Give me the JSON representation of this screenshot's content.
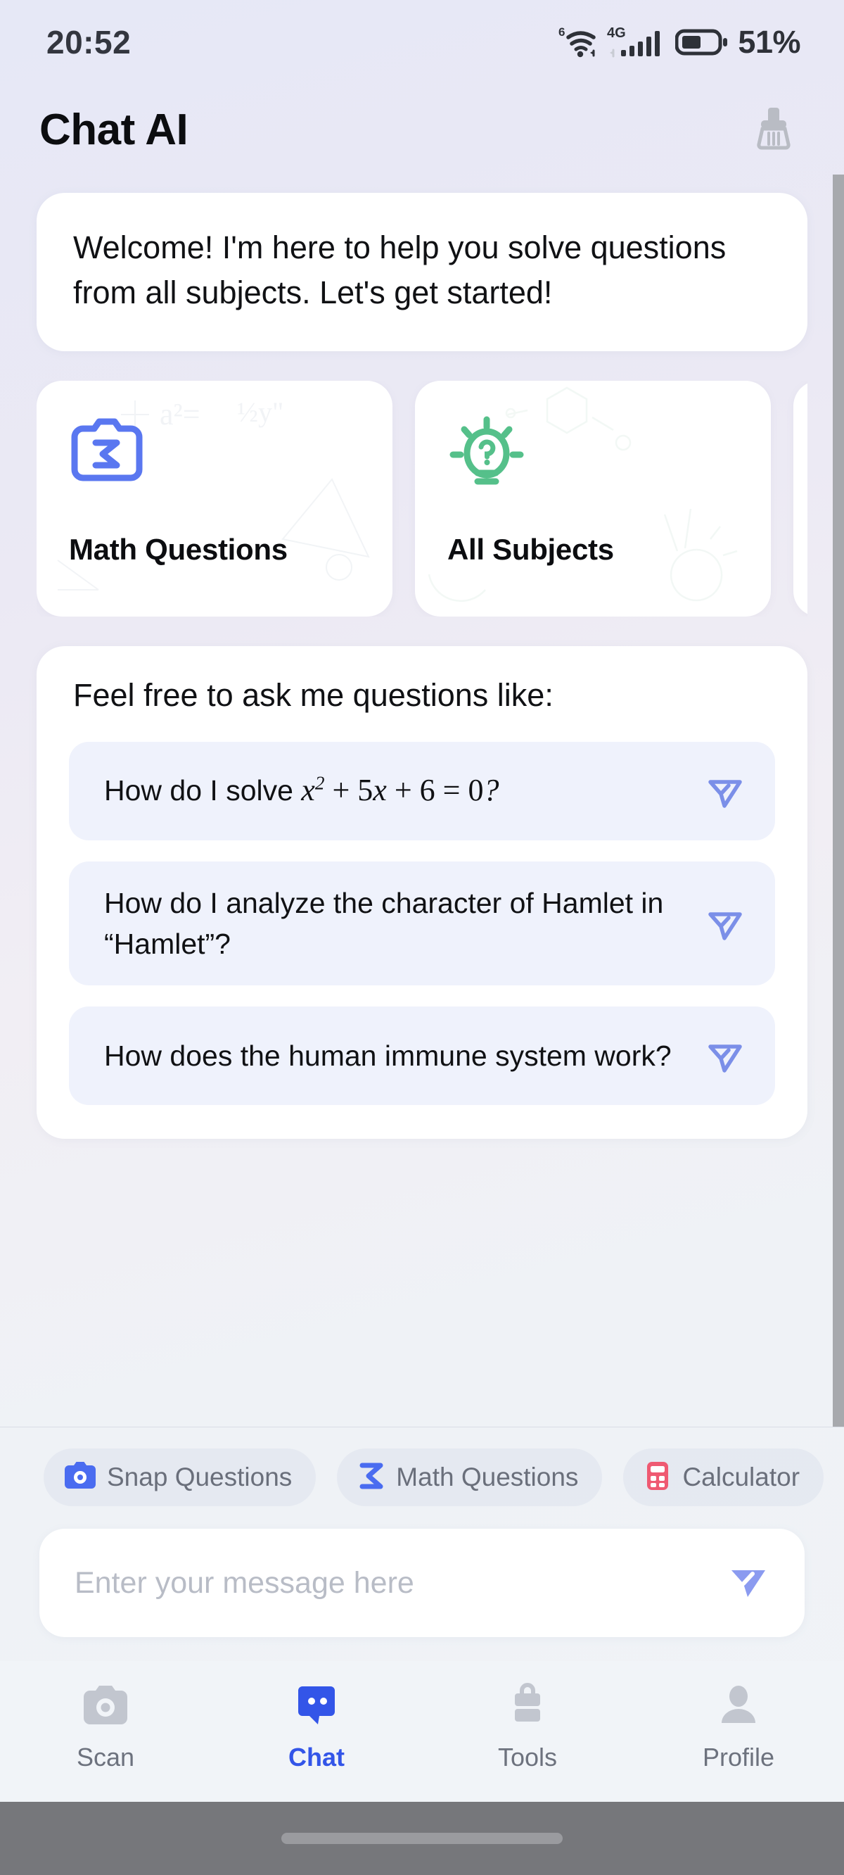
{
  "status_bar": {
    "time": "20:52",
    "wifi_generation": "6",
    "network_type": "4G",
    "battery_percent": "51%"
  },
  "header": {
    "title": "Chat AI",
    "clear_icon": "broom-icon"
  },
  "welcome": {
    "message": "Welcome! I'm here to help you solve questions from all subjects. Let's get started!"
  },
  "categories": [
    {
      "label": "Math Questions",
      "icon": "camera-sigma-icon",
      "color": "#5a77f0"
    },
    {
      "label": "All Subjects",
      "icon": "lightbulb-question-icon",
      "color": "#55c08a"
    }
  ],
  "suggestions": {
    "title": "Feel free to ask me questions like:",
    "items": [
      {
        "text_prefix": "How do I solve ",
        "math": "x² + 5x + 6 = 0?",
        "is_math": true,
        "send_icon": "send-outline-icon"
      },
      {
        "text": "How do I analyze the character of Hamlet in “Hamlet”?",
        "is_math": false,
        "send_icon": "send-outline-icon"
      },
      {
        "text": "How does the human immune system work?",
        "is_math": false,
        "send_icon": "send-outline-icon"
      }
    ]
  },
  "quick_chips": [
    {
      "label": "Snap Questions",
      "icon": "camera-icon",
      "color": "#4a6cf0"
    },
    {
      "label": "Math Questions",
      "icon": "sigma-icon",
      "color": "#4a6cf0"
    },
    {
      "label": "Calculator",
      "icon": "calculator-icon",
      "color": "#ef5a72"
    },
    {
      "label": "",
      "icon": "partial-chip-icon",
      "color": "#f0a23a"
    }
  ],
  "composer": {
    "placeholder": "Enter your message here",
    "value": "",
    "send_icon": "send-filled-icon",
    "send_color": "#8b9bf0"
  },
  "bottom_nav": {
    "active": "Chat",
    "items": [
      {
        "label": "Scan",
        "icon": "camera-icon",
        "active": false
      },
      {
        "label": "Chat",
        "icon": "chat-bubble-icon",
        "active": true
      },
      {
        "label": "Tools",
        "icon": "toolbox-icon",
        "active": false
      },
      {
        "label": "Profile",
        "icon": "person-icon",
        "active": false
      }
    ]
  },
  "theme": {
    "accent_blue": "#3355e8",
    "periwinkle": "#7b8fe8",
    "green": "#55c08a",
    "chip_bg": "#eff2fc",
    "card_bg": "#ffffff"
  }
}
